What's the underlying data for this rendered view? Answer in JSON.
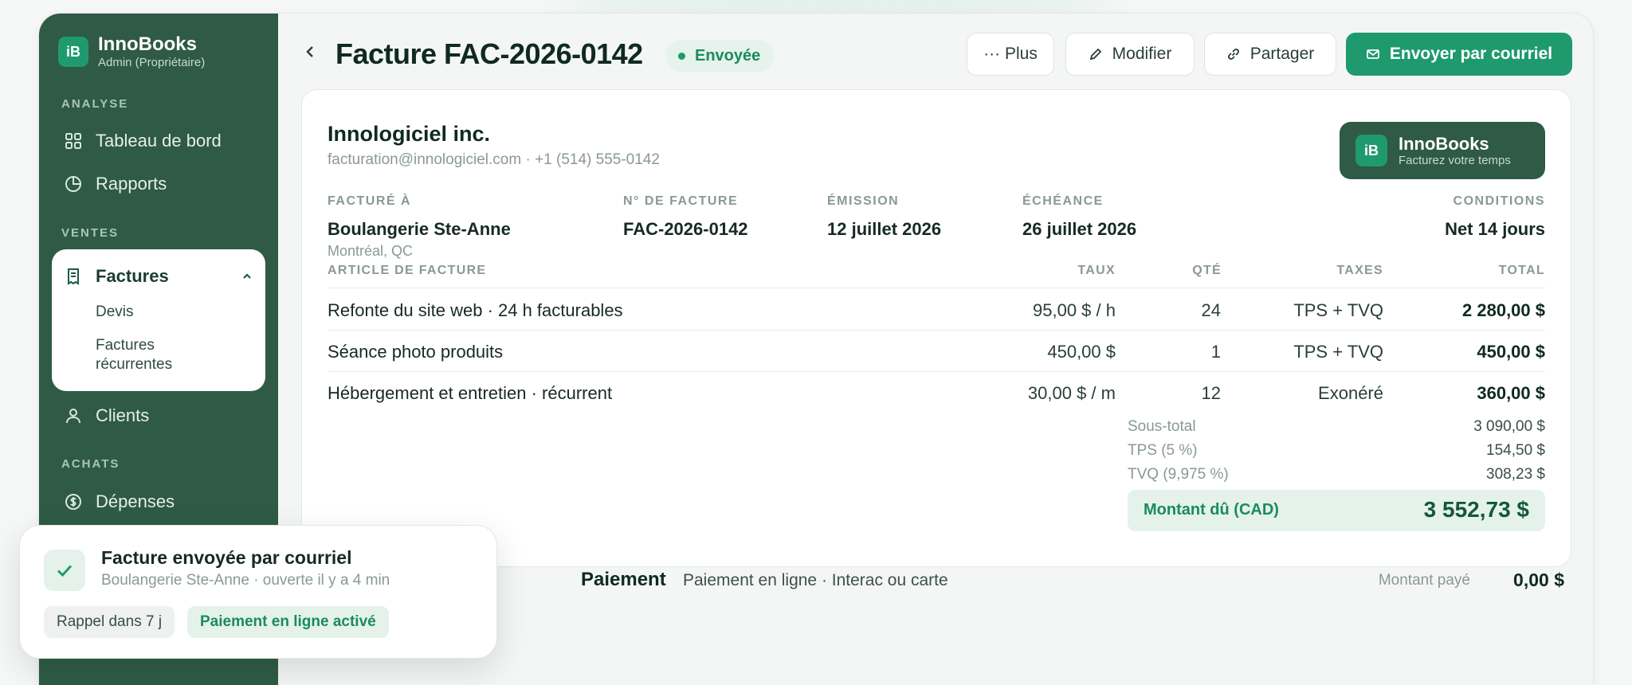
{
  "brand": {
    "logo": "iB",
    "name": "InnoBooks",
    "role": "Admin (Propriétaire)"
  },
  "sidebar": {
    "sections": [
      "ANALYSE",
      "VENTES",
      "ACHATS"
    ],
    "items": {
      "dashboard": "Tableau de bord",
      "reports": "Rapports",
      "invoices": "Factures",
      "quotes": "Devis",
      "recurring": "Factures récurrentes",
      "clients": "Clients",
      "expenses": "Dépenses"
    }
  },
  "header": {
    "title": "Facture FAC-2026-0142",
    "status": "Envoyée",
    "more": "··· Plus",
    "edit": "Modifier",
    "share": "Partager",
    "send": "Envoyer par courriel"
  },
  "invoice": {
    "company": "Innologiciel inc.",
    "contact": "facturation@innologiciel.com · +1 (514) 555-0142",
    "badge": {
      "name": "InnoBooks",
      "tagline": "Facturez votre temps"
    },
    "meta": {
      "billed_to_label": "FACTURÉ À",
      "billed_to": "Boulangerie Ste-Anne",
      "billed_to_city": "Montréal, QC",
      "number_label": "N° DE FACTURE",
      "number": "FAC-2026-0142",
      "issued_label": "ÉMISSION",
      "issued": "12 juillet 2026",
      "due_label": "ÉCHÉANCE",
      "due": "26 juillet 2026",
      "terms_label": "CONDITIONS",
      "terms": "Net 14 jours"
    },
    "columns": [
      "ARTICLE DE FACTURE",
      "TAUX",
      "QTÉ",
      "TAXES",
      "TOTAL"
    ],
    "lines": [
      {
        "desc": "Refonte du site web · 24 h facturables",
        "rate": "95,00 $ / h",
        "qty": "24",
        "tax": "TPS + TVQ",
        "total": "2 280,00 $"
      },
      {
        "desc": "Séance photo produits",
        "rate": "450,00 $",
        "qty": "1",
        "tax": "TPS + TVQ",
        "total": "450,00 $"
      },
      {
        "desc": "Hébergement et entretien · récurrent",
        "rate": "30,00 $ / m",
        "qty": "12",
        "tax": "Exonéré",
        "total": "360,00 $"
      }
    ],
    "summary": {
      "subtotal_label": "Sous-total",
      "subtotal": "3 090,00 $",
      "gst_label": "TPS (5 %)",
      "gst": "154,50 $",
      "qst_label": "TVQ (9,975 %)",
      "qst": "308,23 $",
      "due_label": "Montant dû (CAD)",
      "due": "3 552,73 $"
    }
  },
  "payment": {
    "title": "Paiement",
    "desc": "Paiement en ligne · Interac ou carte",
    "paid_label": "Montant payé",
    "paid": "0,00 $"
  },
  "toast": {
    "title": "Facture envoyée par courriel",
    "sub": "Boulangerie Ste-Anne · ouverte il y a 4 min",
    "chip_reminder": "Rappel dans 7 j",
    "chip_online": "Paiement en ligne activé"
  },
  "colors": {
    "sidebar": "#2f5a45",
    "accent": "#1f9a6e",
    "accent_soft": "#e4f2eb",
    "text": "#172a22"
  }
}
